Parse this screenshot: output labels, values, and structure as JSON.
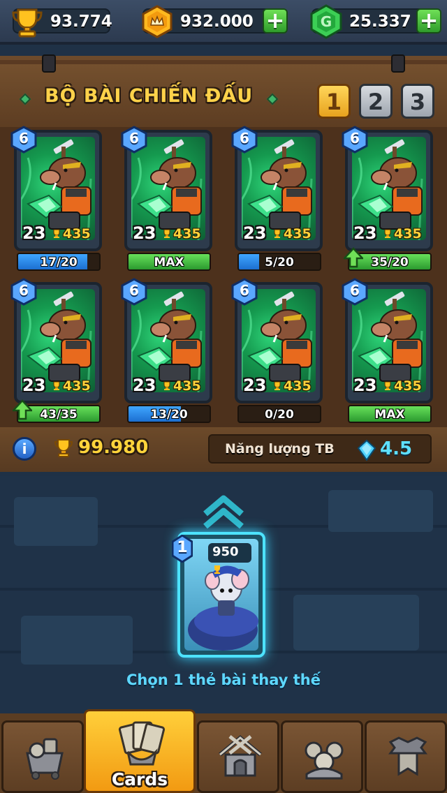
{
  "resources": {
    "trophies": "93.774",
    "gold": "932.000",
    "gems": "25.337"
  },
  "deck": {
    "title": "BỘ BÀI CHIẾN ĐẤU",
    "tabs": [
      "1",
      "2",
      "3"
    ],
    "active_tab": "1",
    "cards": [
      {
        "level": "6",
        "cost": "23",
        "trophies": "435",
        "progress_text": "17/20",
        "progress": 0.85,
        "bar": "blue",
        "upgradable": false
      },
      {
        "level": "6",
        "cost": "23",
        "trophies": "435",
        "progress_text": "MAX",
        "progress": 1.0,
        "bar": "green",
        "upgradable": false
      },
      {
        "level": "6",
        "cost": "23",
        "trophies": "435",
        "progress_text": "5/20",
        "progress": 0.25,
        "bar": "blue",
        "upgradable": false
      },
      {
        "level": "6",
        "cost": "23",
        "trophies": "435",
        "progress_text": "35/20",
        "progress": 1.0,
        "bar": "green",
        "upgradable": true
      },
      {
        "level": "6",
        "cost": "23",
        "trophies": "435",
        "progress_text": "43/35",
        "progress": 1.0,
        "bar": "green",
        "upgradable": true
      },
      {
        "level": "6",
        "cost": "23",
        "trophies": "435",
        "progress_text": "13/20",
        "progress": 0.65,
        "bar": "blue",
        "upgradable": false
      },
      {
        "level": "6",
        "cost": "23",
        "trophies": "435",
        "progress_text": "0/20",
        "progress": 0.0,
        "bar": "blue",
        "upgradable": false
      },
      {
        "level": "6",
        "cost": "23",
        "trophies": "435",
        "progress_text": "MAX",
        "progress": 1.0,
        "bar": "green",
        "upgradable": false
      }
    ],
    "total_trophies": "99.980",
    "avg_energy_label": "Năng lượng TB",
    "avg_energy": "4.5",
    "info_label": "i"
  },
  "selected_card": {
    "level": "1",
    "trophies": "950",
    "hint": "Chọn 1 thẻ bài thay thế"
  },
  "nav": {
    "items": [
      "",
      "Cards",
      "",
      "",
      ""
    ],
    "active": "Cards"
  },
  "colors": {
    "gold_text": "#ffd43b",
    "energy_text": "#5ee0ff",
    "hint_text": "#5ed8ff",
    "active_nav": "#f29a12"
  }
}
